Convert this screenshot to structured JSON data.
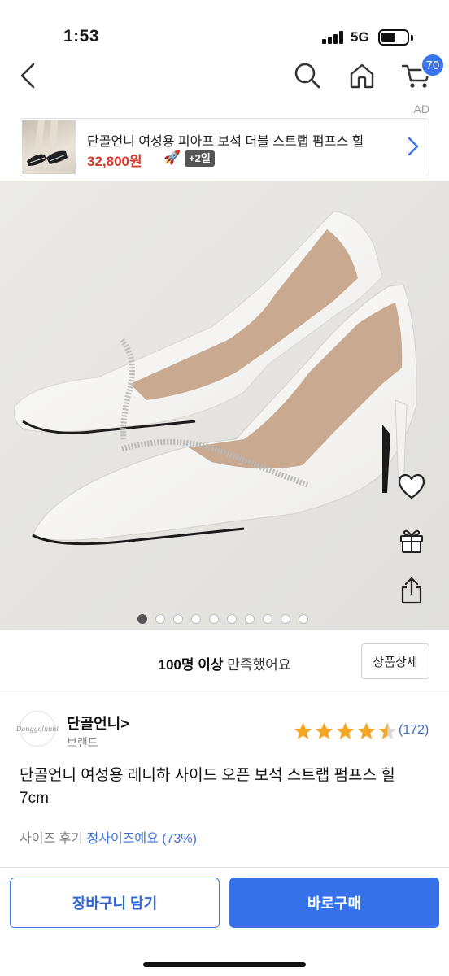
{
  "status": {
    "time": "1:53",
    "network": "5G",
    "battery_level": 0.58
  },
  "nav": {
    "cart_count": "70",
    "icons": [
      "back-icon",
      "search-icon",
      "home-icon",
      "cart-icon"
    ]
  },
  "ad": {
    "label": "AD",
    "title": "단골언니 여성용 피아프 보석 더블 스트랩 펌프스 힐",
    "price": "32,800원",
    "rocket": "🚀",
    "delivery": "+2일"
  },
  "gallery": {
    "image_count": 10,
    "active_index": 0,
    "image_alt": "white pumps"
  },
  "satisfaction": {
    "bold": "100명 이상",
    "rest": " 만족했어요",
    "detail_button": "상품상세"
  },
  "brand": {
    "logo_text": "Danggolunni",
    "name": "단골언니",
    "chevron": ">",
    "sub": "브랜드"
  },
  "rating": {
    "value": 4.5,
    "max": 5,
    "count": "(172)",
    "star_color": "#f5a623"
  },
  "product": {
    "title": "단골언니 여성용 레니하 사이드 오픈 보석 스트랩 펌프스 힐 7cm"
  },
  "size_review": {
    "label": "사이즈 후기 ",
    "value": "정사이즈예요 (73%)"
  },
  "actions": {
    "add_to_cart": "장바구니 담기",
    "buy_now": "바로구매"
  },
  "colors": {
    "accent": "#3572ea",
    "price_red": "#d23a2e"
  }
}
